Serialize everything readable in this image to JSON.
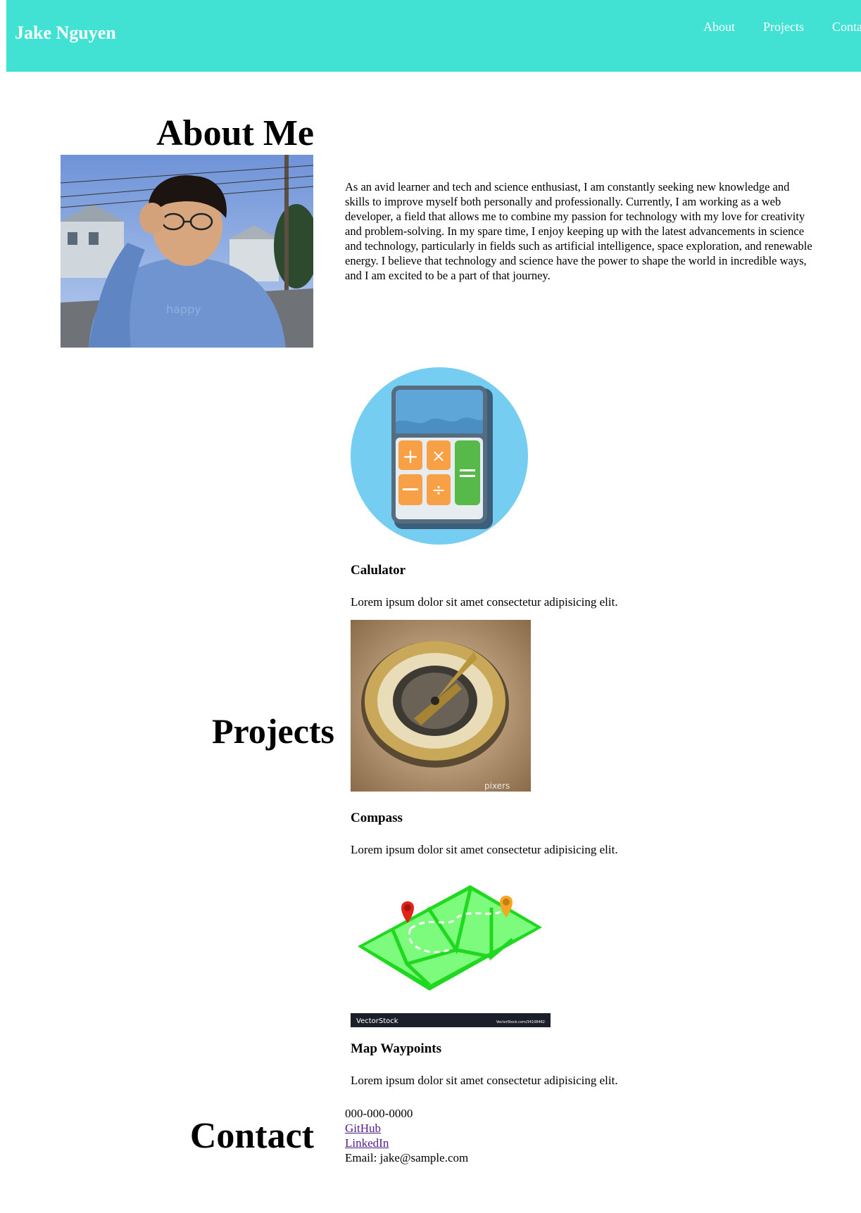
{
  "header": {
    "brand": "Jake Nguyen",
    "nav": [
      {
        "label": "About"
      },
      {
        "label": "Projects"
      },
      {
        "label": "Contact"
      }
    ],
    "color": "#41e2d3"
  },
  "about": {
    "title": "About Me",
    "bio": "As an avid learner and tech and science enthusiast, I am constantly seeking new knowledge and skills to improve myself both personally and professionally. Currently, I am working as a web developer, a field that allows me to combine my passion for technology with my love for creativity and problem-solving. In my spare time, I enjoy keeping up with the latest advancements in science and technology, particularly in fields such as artificial intelligence, space exploration, and renewable energy. I believe that technology and science have the power to shape the world in incredible ways, and I am excited to be a part of that journey."
  },
  "projects": {
    "title": "Projects",
    "items": [
      {
        "name": "Calulator",
        "desc": "Lorem ipsum dolor sit amet consectetur adipisicing elit."
      },
      {
        "name": "Compass",
        "desc": "Lorem ipsum dolor sit amet consectetur adipisicing elit."
      },
      {
        "name": "Map Waypoints",
        "desc": "Lorem ipsum dolor sit amet consectetur adipisicing elit."
      }
    ],
    "image_watermarks": {
      "compass": "pixers",
      "map_left": "VectorStock",
      "map_right": "VectorStock.com/34108482"
    }
  },
  "contact": {
    "title": "Contact",
    "phone": "000-000-0000",
    "github": "GitHub",
    "linkedin": "LinkedIn",
    "email": "Email: jake@sample.com"
  }
}
